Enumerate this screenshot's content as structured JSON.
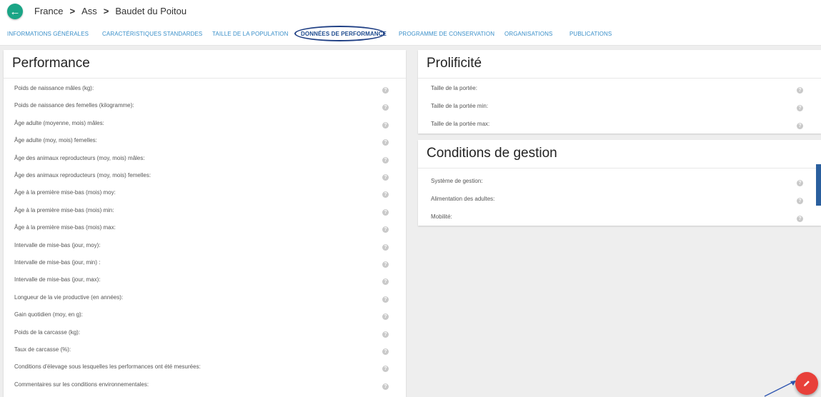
{
  "breadcrumb": {
    "items": [
      "France",
      "Ass",
      "Baudet du Poitou"
    ],
    "separator": ">"
  },
  "tabs": [
    {
      "label": "INFORMATIONS GÉNÉRALES",
      "active": false
    },
    {
      "label": "CARACTÉRISTIQUES STANDARDES",
      "active": false
    },
    {
      "label": "TAILLE DE LA POPULATION",
      "active": false
    },
    {
      "label": "DONNÉES DE PERFORMANCE",
      "active": true
    },
    {
      "label": "PROGRAMME DE CONSERVATION",
      "active": false
    },
    {
      "label": "ORGANISATIONS",
      "active": false
    },
    {
      "label": "PUBLICATIONS",
      "active": false
    }
  ],
  "performance": {
    "title": "Performance",
    "fields": [
      "Poids de naissance mâles (kg):",
      "Poids de naissance des femelles (kilogramme):",
      "Âge adulte (moyenne, mois) mâles:",
      "Âge adulte (moy, mois) femelles:",
      "Âge des animaux reproducteurs (moy, mois) mâles:",
      "Âge des animaux reproducteurs (moy, mois) femelles:",
      "Âge à la première mise-bas (mois) moy:",
      "Âge à la première mise-bas (mois) min:",
      "Âge à la première mise-bas (mois) max:",
      "Intervalle de mise-bas (jour, moy):",
      "Intervalle de mise-bas (jour, min) :",
      "Intervalle de mise-bas (jour, max):",
      "Longueur de la vie productive (en années):",
      "Gain quotidien (moy, en g):",
      "Poids de la carcasse (kg):",
      "Taux de carcasse (%):",
      "Conditions d'élevage sous lesquelles les performances ont été mesurées:",
      "Commentaires sur les conditions environnementales:"
    ]
  },
  "prolificite": {
    "title": "Prolificité",
    "fields": [
      "Taille de la portée:",
      "Taille de la portée min:",
      "Taille de la portée max:"
    ]
  },
  "conditions": {
    "title": "Conditions de gestion",
    "fields": [
      "Système de gestion:",
      "Alimentation des adultes:",
      "Mobilité:"
    ]
  },
  "icons": {
    "back": "arrow-left-icon",
    "help": "question-mark-icon",
    "fab": "pencil-icon"
  },
  "colors": {
    "back_button": "#1aa586",
    "tab_link": "#3a8fc9",
    "tab_active": "#1f4c8f",
    "fab": "#e8403a",
    "annotation": "#1f3f84"
  }
}
